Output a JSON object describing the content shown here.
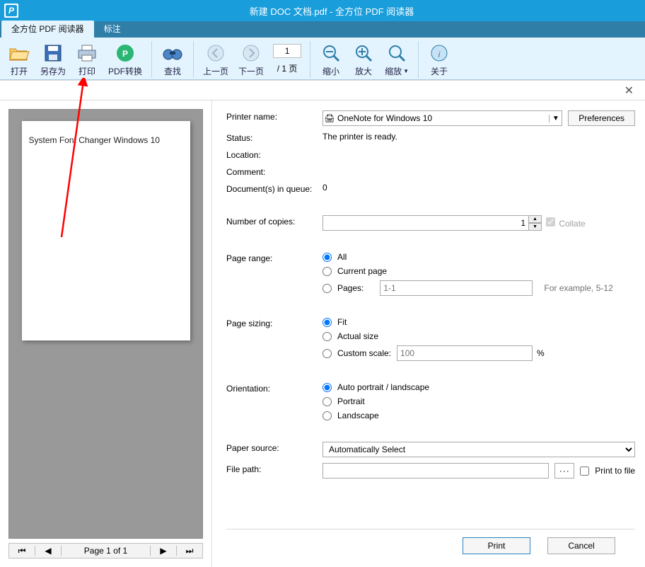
{
  "window": {
    "title": "新建 DOC 文档.pdf - 全方位 PDF 阅读器"
  },
  "tabs": {
    "main": "全方位 PDF 阅读器",
    "annotate": "标注"
  },
  "ribbon": {
    "open": "打开",
    "saveas": "另存为",
    "print": "打印",
    "convert": "PDF转换",
    "find": "查找",
    "prev": "上一页",
    "next": "下一页",
    "page_value": "1",
    "page_total": "/ 1 页",
    "zoom_out": "缩小",
    "zoom_in": "放大",
    "zoom": "缩放",
    "about": "关于"
  },
  "preview": {
    "page_text": "System Font Changer Windows 10",
    "nav_label": "Page 1 of 1"
  },
  "print": {
    "labels": {
      "printer_name": "Printer name:",
      "status": "Status:",
      "location": "Location:",
      "comment": "Comment:",
      "queue": "Document(s) in queue:",
      "copies": "Number of copies:",
      "page_range": "Page range:",
      "page_sizing": "Page sizing:",
      "orientation": "Orientation:",
      "paper_source": "Paper source:",
      "file_path": "File path:"
    },
    "printer_selected": "OneNote for Windows 10",
    "preferences": "Preferences",
    "status_value": "The printer is ready.",
    "queue_value": "0",
    "copies_value": "1",
    "collate": "Collate",
    "range": {
      "all": "All",
      "current": "Current page",
      "pages": "Pages:",
      "pages_placeholder": "1-1",
      "hint": "For example, 5-12"
    },
    "sizing": {
      "fit": "Fit",
      "actual": "Actual size",
      "custom": "Custom scale:",
      "custom_placeholder": "100",
      "percent": "%"
    },
    "orientation": {
      "auto": "Auto portrait / landscape",
      "portrait": "Portrait",
      "landscape": "Landscape"
    },
    "paper_source_value": "Automatically Select",
    "print_to_file": "Print to file",
    "buttons": {
      "print": "Print",
      "cancel": "Cancel"
    }
  }
}
